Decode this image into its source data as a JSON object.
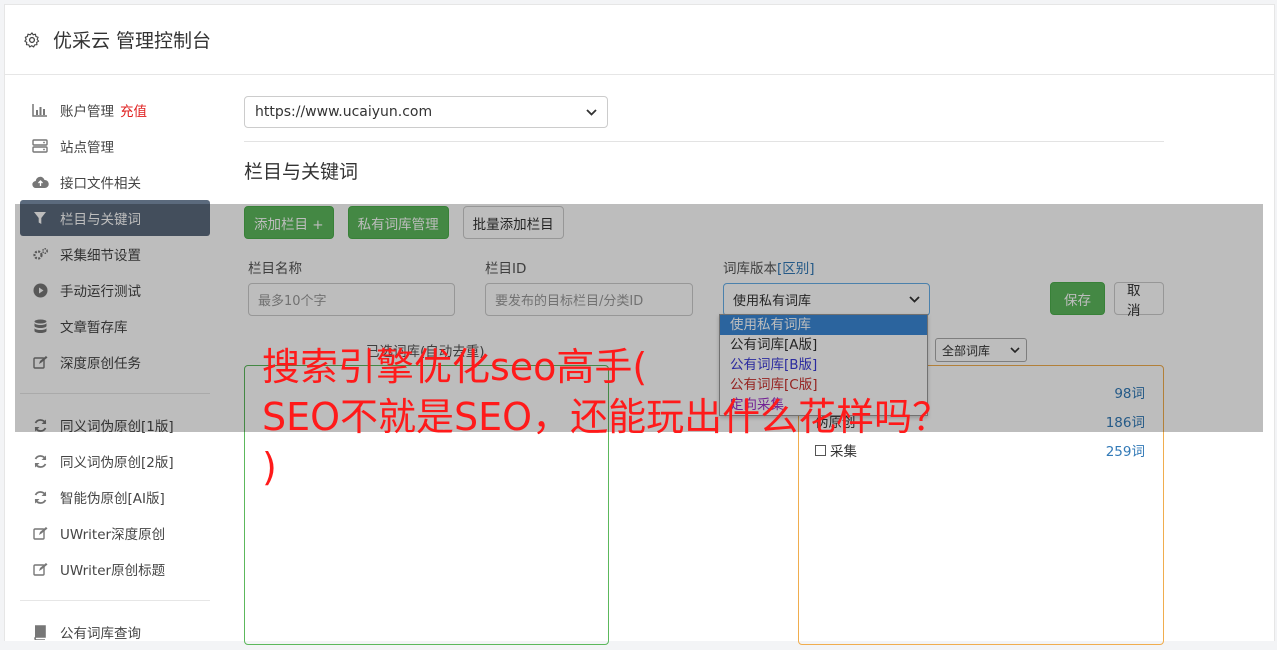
{
  "header": {
    "title": "优采云 管理控制台"
  },
  "sidebar": {
    "items": [
      {
        "label": "账户管理",
        "badge": "充值",
        "icon": "bar-chart-icon"
      },
      {
        "label": "站点管理",
        "icon": "server-icon"
      },
      {
        "label": "接口文件相关",
        "icon": "cloud-upload-icon"
      },
      {
        "label": "栏目与关键词",
        "icon": "filter-icon"
      },
      {
        "label": "采集细节设置",
        "icon": "cogs-icon"
      },
      {
        "label": "手动运行测试",
        "icon": "play-circle-icon"
      },
      {
        "label": "文章暂存库",
        "icon": "database-icon"
      },
      {
        "label": "深度原创任务",
        "icon": "edit-icon"
      }
    ],
    "items2": [
      {
        "label": "同义词伪原创[1版]",
        "icon": "refresh-icon"
      },
      {
        "label": "同义词伪原创[2版]",
        "icon": "refresh-icon"
      },
      {
        "label": "智能伪原创[AI版]",
        "icon": "refresh-icon"
      },
      {
        "label": "UWriter深度原创",
        "icon": "edit-icon"
      },
      {
        "label": "UWriter原创标题",
        "icon": "edit-icon"
      }
    ],
    "items3": [
      {
        "label": "公有词库查询",
        "icon": "book-icon"
      }
    ]
  },
  "main": {
    "site_select": "https://www.ucaiyun.com",
    "section_title": "栏目与关键词",
    "buttons": {
      "add_column": "添加栏目 +",
      "private_lib": "私有词库管理",
      "batch_add": "批量添加栏目"
    },
    "form": {
      "name_label": "栏目名称",
      "name_placeholder": "最多10个字",
      "id_label": "栏目ID",
      "id_placeholder": "要发布的目标栏目/分类ID",
      "lib_label": "词库版本",
      "lib_link": "[区别]",
      "lib_value": "使用私有词库",
      "save": "保存",
      "cancel": "取消"
    },
    "dropdown_options": [
      {
        "label": "使用私有词库",
        "color": "#ffffff"
      },
      {
        "label": "公有词库[A版]",
        "color": "#333333"
      },
      {
        "label": "公有词库[B版]",
        "color": "#3b3bd6"
      },
      {
        "label": "公有词库[C版]",
        "color": "#c9302c"
      },
      {
        "label": "定向采集",
        "color": "#9b30c8"
      }
    ],
    "selected_words_label": "已选词库(自动去重)",
    "all_lib_filter": "全部词库",
    "lib_rows": [
      {
        "name": "",
        "count": "98词"
      },
      {
        "name": "伪原创",
        "count": "186词"
      },
      {
        "name": "采集",
        "count": "259词"
      }
    ]
  },
  "watermark": "搜索引擎优化seo高手(\nSEO不就是SEO，还能玩出什么花样吗？\n)"
}
